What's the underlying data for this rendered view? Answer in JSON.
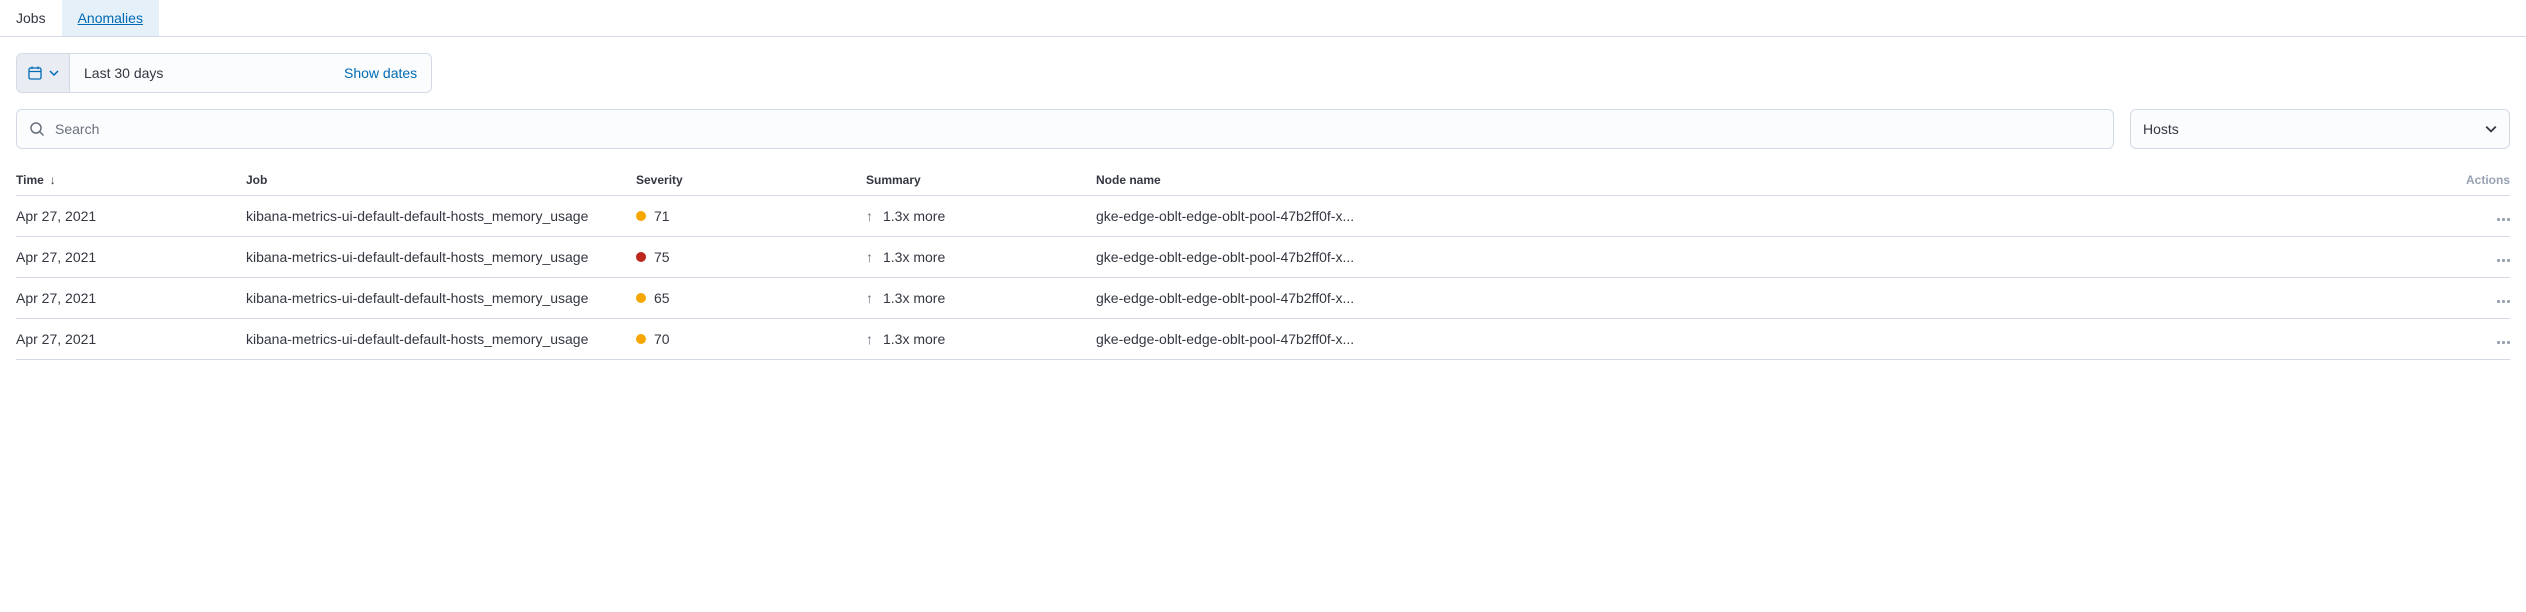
{
  "tabs": {
    "jobs": "Jobs",
    "anomalies": "Anomalies"
  },
  "date_picker": {
    "label": "Last 30 days",
    "show_dates": "Show dates"
  },
  "search": {
    "placeholder": "Search"
  },
  "filter": {
    "selected": "Hosts"
  },
  "columns": {
    "time": "Time",
    "job": "Job",
    "severity": "Severity",
    "summary": "Summary",
    "node": "Node name",
    "actions": "Actions"
  },
  "rows": [
    {
      "time": "Apr 27, 2021",
      "job": "kibana-metrics-ui-default-default-hosts_memory_usage",
      "severity": "71",
      "severity_color": "orange",
      "summary": "1.3x more",
      "node": "gke-edge-oblt-edge-oblt-pool-47b2ff0f-x..."
    },
    {
      "time": "Apr 27, 2021",
      "job": "kibana-metrics-ui-default-default-hosts_memory_usage",
      "severity": "75",
      "severity_color": "red",
      "summary": "1.3x more",
      "node": "gke-edge-oblt-edge-oblt-pool-47b2ff0f-x..."
    },
    {
      "time": "Apr 27, 2021",
      "job": "kibana-metrics-ui-default-default-hosts_memory_usage",
      "severity": "65",
      "severity_color": "orange",
      "summary": "1.3x more",
      "node": "gke-edge-oblt-edge-oblt-pool-47b2ff0f-x..."
    },
    {
      "time": "Apr 27, 2021",
      "job": "kibana-metrics-ui-default-default-hosts_memory_usage",
      "severity": "70",
      "severity_color": "orange",
      "summary": "1.3x more",
      "node": "gke-edge-oblt-edge-oblt-pool-47b2ff0f-x..."
    }
  ]
}
